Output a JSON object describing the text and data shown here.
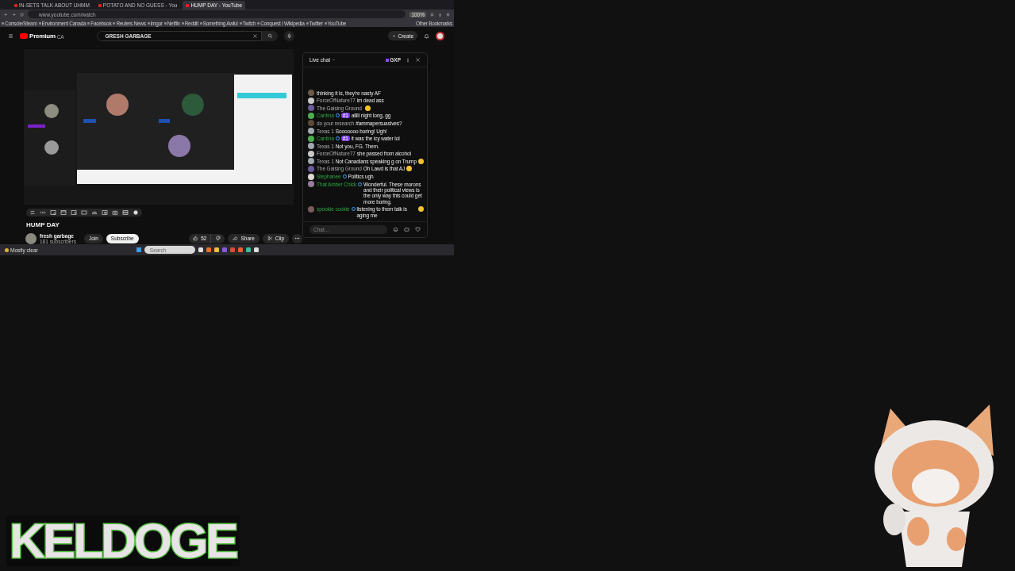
{
  "browser": {
    "tabs": [
      {
        "label": "IN-SETS TALK ABOUT UHMM",
        "selected": false
      },
      {
        "label": "POTATO AND NO GUESS - You",
        "selected": false
      },
      {
        "label": "HUMP DAY - YouTube",
        "selected": true
      }
    ],
    "address": "www.youtube.com/watch",
    "zoom": "100%",
    "bookmarks": [
      "Console/Steam",
      "Environment Canada",
      "Facebook",
      "Reuters News",
      "Imgur",
      "Netflix",
      "Reddit",
      "Something Awful",
      "Twitch",
      "Conquest / Wikipedia",
      "Twitter",
      "YouTube"
    ],
    "other_bookmarks": "Other Bookmarks"
  },
  "youtube": {
    "logo": "Premium",
    "region": "CA",
    "search": "GRESH GARBAGE",
    "create": "Create"
  },
  "video": {
    "title": "HUMP DAY",
    "channel": "fresh garbage",
    "subscribers": "181 subscribers",
    "join": "Join",
    "subscribe": "Subscribe",
    "likes": "52",
    "share": "Share",
    "clip": "Clip"
  },
  "chat": {
    "title": "Live chat",
    "points": "GXP",
    "placeholder": "Chat...",
    "messages": [
      {
        "message": "thinking it is, they're nasty AF",
        "member": false,
        "color": "#6a5a4a",
        "emoji": false
      },
      {
        "author": "ForceOfNature77",
        "message": "im dead ass",
        "member": false,
        "color": "#c8c8c8",
        "emoji": false
      },
      {
        "author": "The Gaising Ground",
        "member": false,
        "color": "#6c5a9a",
        "emoji": true
      },
      {
        "author": "Cantina",
        "badge": "#1",
        "message": "alllll night long, gg",
        "member": true,
        "color": "#4caf50",
        "emoji": false
      },
      {
        "author": "do your research",
        "message": "#ammapersuasives?",
        "member": false,
        "color": "#5a4a3a",
        "emoji": false
      },
      {
        "author": "Texas 1",
        "message": "Sooooooo boring! Ugh!",
        "member": false,
        "color": "#a0a8b0",
        "emoji": false
      },
      {
        "author": "Cantina",
        "badge": "#1",
        "message": "it was the icy water lol",
        "member": true,
        "color": "#4caf50",
        "emoji": false
      },
      {
        "author": "Texas 1",
        "message": "Not you, FG. Them.",
        "member": false,
        "color": "#a0a8b0",
        "emoji": false
      },
      {
        "author": "ForceOfNature77",
        "message": "she passed from alcohol",
        "member": false,
        "color": "#c8c8c8",
        "emoji": false
      },
      {
        "author": "Texas 1",
        "message": "Not Canadians speaking g on Trump",
        "member": false,
        "color": "#a0a8b0",
        "emoji": true
      },
      {
        "author": "The Gaising Ground",
        "message": "Oh Lawd is that AJ",
        "member": false,
        "color": "#6c5a9a",
        "emoji": true
      },
      {
        "author": "Stephanee",
        "message": "Politics ugh",
        "member": true,
        "color": "#e0d8d0",
        "emoji": false
      },
      {
        "author": "That Amber Chick",
        "message": "Wonderful. These morons and their political views is the only way this could get more boring.",
        "member": true,
        "color": "#9a7a9a",
        "emoji": false
      },
      {
        "author": "spookie cookie",
        "message": "listening to them talk is aging me",
        "member": true,
        "color": "#7a5a5a",
        "emoji": true
      }
    ]
  },
  "taskbar": {
    "weather": "Mostly clear",
    "search_placeholder": "Search"
  },
  "overlay": {
    "logo": "KELDOGE"
  }
}
